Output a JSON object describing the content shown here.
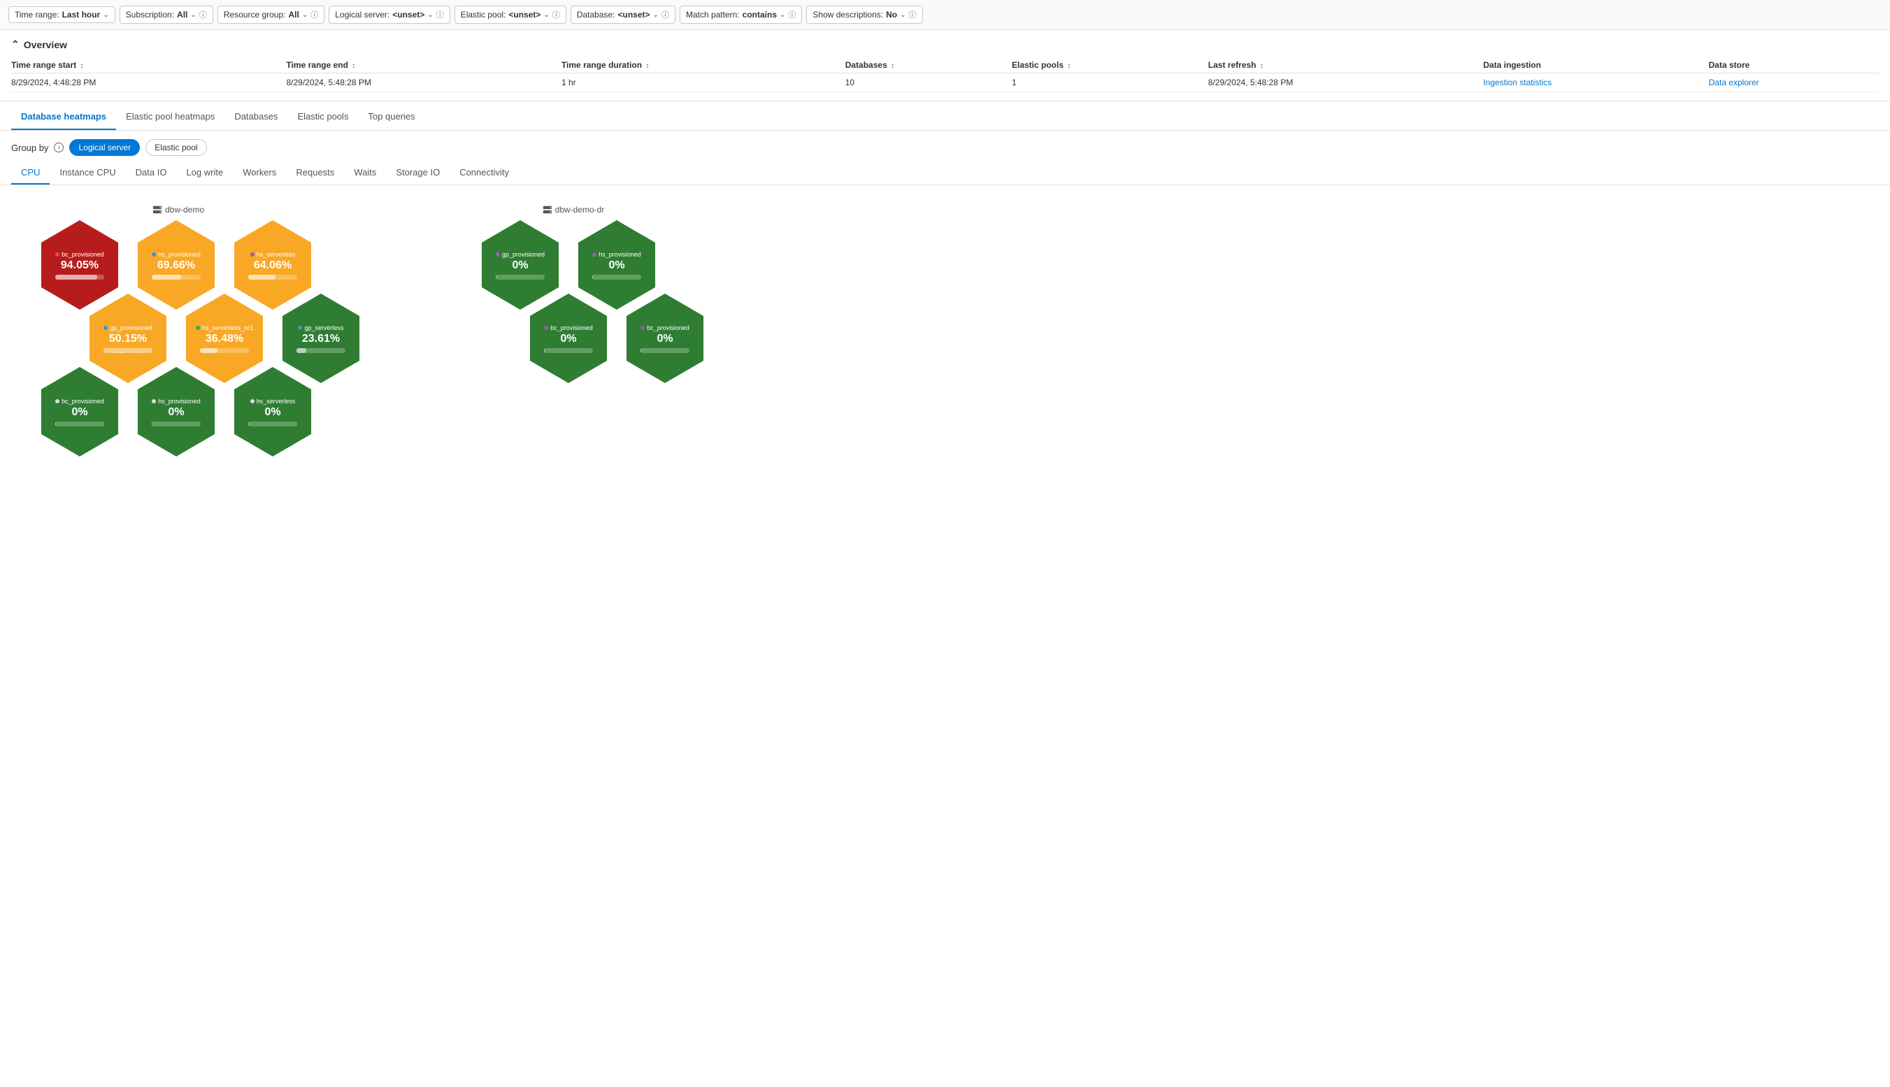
{
  "filters": {
    "time_range": {
      "label": "Time range:",
      "value": "Last hour"
    },
    "subscription": {
      "label": "Subscription:",
      "value": "All"
    },
    "resource_group": {
      "label": "Resource group:",
      "value": "All"
    },
    "logical_server": {
      "label": "Logical server:",
      "value": "<unset>"
    },
    "elastic_pool": {
      "label": "Elastic pool:",
      "value": "<unset>"
    },
    "database": {
      "label": "Database:",
      "value": "<unset>"
    },
    "match_pattern": {
      "label": "Match pattern:",
      "value": "contains"
    },
    "show_descriptions": {
      "label": "Show descriptions:",
      "value": "No"
    }
  },
  "overview": {
    "toggle_label": "Overview",
    "table": {
      "headers": [
        {
          "label": "Time range start",
          "sortable": true
        },
        {
          "label": "Time range end",
          "sortable": true
        },
        {
          "label": "Time range duration",
          "sortable": true
        },
        {
          "label": "Databases",
          "sortable": true
        },
        {
          "label": "Elastic pools",
          "sortable": true
        },
        {
          "label": "Last refresh",
          "sortable": true
        },
        {
          "label": "Data ingestion",
          "sortable": false
        },
        {
          "label": "Data store",
          "sortable": false
        }
      ],
      "rows": [
        {
          "time_start": "8/29/2024, 4:48:28 PM",
          "time_end": "8/29/2024, 5:48:28 PM",
          "duration": "1 hr",
          "databases": "10",
          "elastic_pools": "1",
          "last_refresh": "8/29/2024, 5:48:28 PM",
          "data_ingestion": "Ingestion statistics",
          "data_store": "Data explorer"
        }
      ]
    }
  },
  "main_tabs": [
    {
      "label": "Database heatmaps",
      "active": true
    },
    {
      "label": "Elastic pool heatmaps",
      "active": false
    },
    {
      "label": "Databases",
      "active": false
    },
    {
      "label": "Elastic pools",
      "active": false
    },
    {
      "label": "Top queries",
      "active": false
    }
  ],
  "group_by": {
    "label": "Group by",
    "options": [
      {
        "label": "Logical server",
        "active": true
      },
      {
        "label": "Elastic pool",
        "active": false
      }
    ]
  },
  "sub_tabs": [
    {
      "label": "CPU",
      "active": true
    },
    {
      "label": "Instance CPU",
      "active": false
    },
    {
      "label": "Data IO",
      "active": false
    },
    {
      "label": "Log write",
      "active": false
    },
    {
      "label": "Workers",
      "active": false
    },
    {
      "label": "Requests",
      "active": false
    },
    {
      "label": "Waits",
      "active": false
    },
    {
      "label": "Storage IO",
      "active": false
    },
    {
      "label": "Connectivity",
      "active": false
    }
  ],
  "clusters": [
    {
      "name": "dbw-demo",
      "icon": "server-icon",
      "hexagons": [
        {
          "id": "h1",
          "label": "bc_provisioned",
          "dot_color": "#e74c3c",
          "percent": "94.05%",
          "color": "red",
          "bar_width": "85"
        },
        {
          "id": "h2",
          "label": "hs_provisioned",
          "dot_color": "#3498db",
          "percent": "69.66%",
          "color": "yellow",
          "bar_width": "60"
        },
        {
          "id": "h3",
          "label": "hs_serverless",
          "dot_color": "#9b59b6",
          "percent": "64.06%",
          "color": "yellow",
          "bar_width": "55"
        },
        {
          "id": "h4",
          "label": "gp_provisioned",
          "dot_color": "#3498db",
          "percent": "50.15%",
          "color": "yellow",
          "bar_width": "45"
        },
        {
          "id": "h5",
          "label": "hs_serverless_nr1",
          "dot_color": "#27ae60",
          "percent": "36.48%",
          "color": "yellow",
          "bar_width": "35"
        },
        {
          "id": "h6",
          "label": "gp_serverless",
          "dot_color": "#3498db",
          "percent": "23.61%",
          "color": "green",
          "bar_width": "20"
        },
        {
          "id": "h7",
          "label": "bc_provisioned",
          "dot_color": "#e0e0e0",
          "percent": "0%",
          "color": "green",
          "bar_width": "2"
        },
        {
          "id": "h8",
          "label": "hs_provisioned",
          "dot_color": "#e0e0e0",
          "percent": "0%",
          "color": "green",
          "bar_width": "2"
        },
        {
          "id": "h9",
          "label": "hs_serverless",
          "dot_color": "#e0e0e0",
          "percent": "0%",
          "color": "green",
          "bar_width": "2"
        }
      ]
    },
    {
      "name": "dbw-demo-dr",
      "icon": "server-icon",
      "hexagons": [
        {
          "id": "d1",
          "label": "gp_provisioned",
          "dot_color": "#9b59b6",
          "percent": "0%",
          "color": "green",
          "bar_width": "2"
        },
        {
          "id": "d2",
          "label": "hs_provisioned",
          "dot_color": "#9b59b6",
          "percent": "0%",
          "color": "green",
          "bar_width": "2"
        },
        {
          "id": "d3",
          "label": "bc_provisioned",
          "dot_color": "#9b59b6",
          "percent": "0%",
          "color": "green",
          "bar_width": "2"
        },
        {
          "id": "d4",
          "label": "bc_provisioned",
          "dot_color": "#9b59b6",
          "percent": "0%",
          "color": "green",
          "bar_width": "2"
        }
      ]
    }
  ]
}
